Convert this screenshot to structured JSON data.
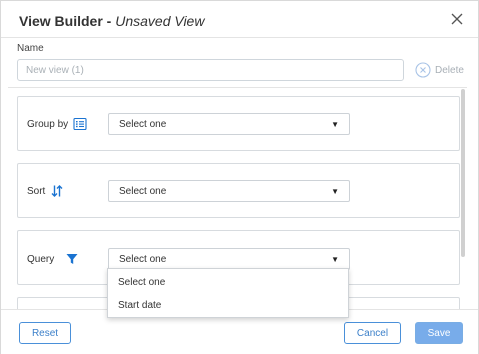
{
  "dialog": {
    "title_bold": "View Builder - ",
    "title_italic": "Unsaved View"
  },
  "name": {
    "label": "Name",
    "placeholder": "New view (1)",
    "value": ""
  },
  "delete_label": "Delete",
  "sections": {
    "group_by": {
      "label": "Group by",
      "icon": "list-icon",
      "selected": "Select one"
    },
    "sort": {
      "label": "Sort",
      "icon": "sort-arrows-icon",
      "selected": "Select one"
    },
    "query": {
      "label": "Query",
      "icon": "filter-icon",
      "selected": "Select one"
    }
  },
  "query_dropdown": {
    "options": [
      "Select one",
      "Start date"
    ]
  },
  "footer": {
    "reset_label": "Reset",
    "cancel_label": "Cancel",
    "save_label": "Save"
  },
  "colors": {
    "accent": "#1a73d1",
    "primary_button": "#78acea",
    "outline_button": "#4a90d9"
  }
}
